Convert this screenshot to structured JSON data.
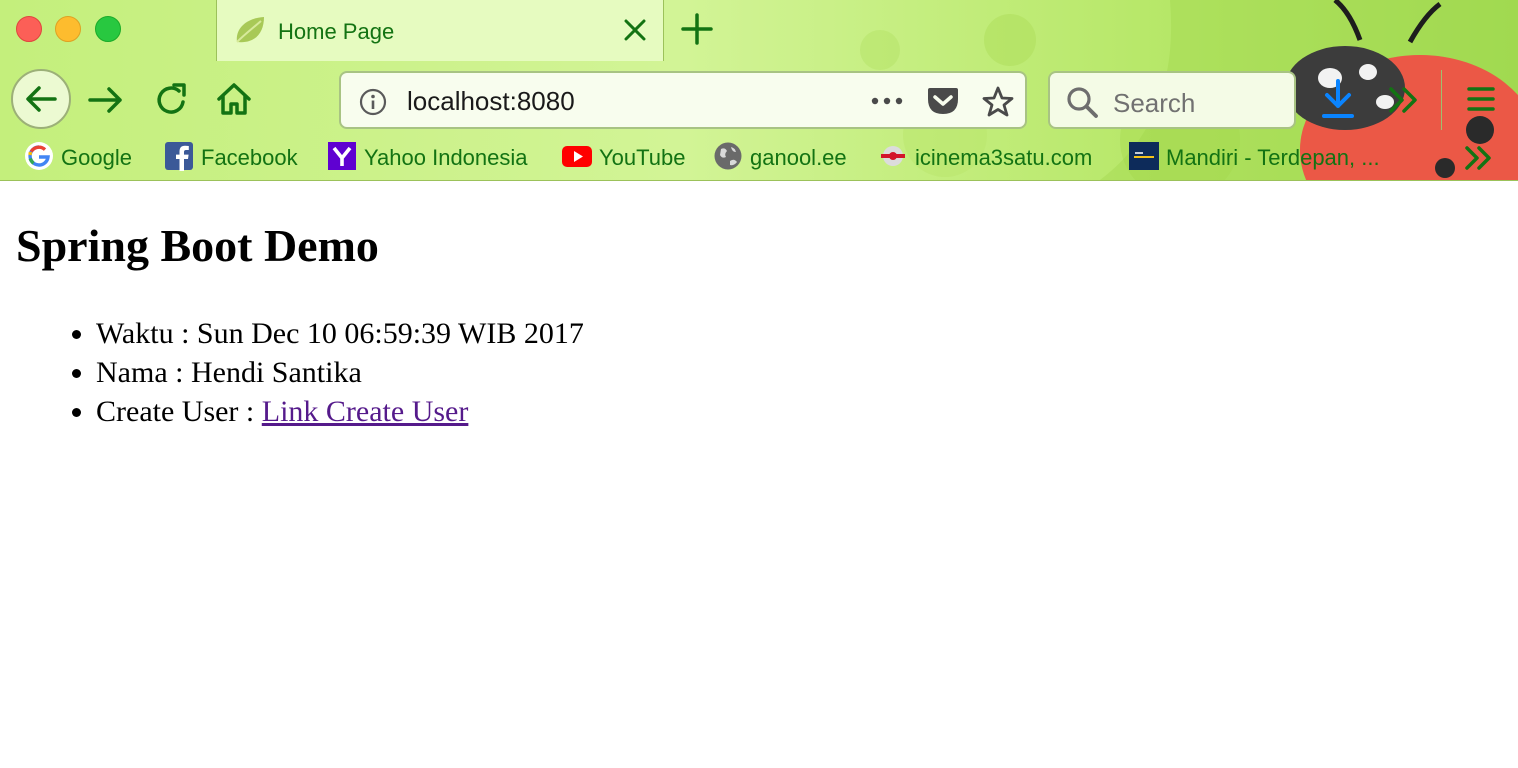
{
  "browser": {
    "tab": {
      "title": "Home Page"
    },
    "url": "localhost:8080",
    "search_placeholder": "Search",
    "bookmarks": [
      {
        "label": "Google",
        "icon": "google-icon"
      },
      {
        "label": "Facebook",
        "icon": "facebook-icon"
      },
      {
        "label": "Yahoo Indonesia",
        "icon": "yahoo-icon"
      },
      {
        "label": "YouTube",
        "icon": "youtube-icon"
      },
      {
        "label": "ganool.ee",
        "icon": "globe-icon"
      },
      {
        "label": "icinema3satu.com",
        "icon": "icinema-icon"
      },
      {
        "label": "Mandiri - Terdepan, ...",
        "icon": "mandiri-icon"
      }
    ],
    "colors": {
      "toolbar_icon": "#137313",
      "download_icon": "#0a84ff",
      "theme_green": "#c4ef7c"
    }
  },
  "page": {
    "heading": "Spring Boot Demo",
    "items": [
      {
        "label": "Waktu : ",
        "value": "Sun Dec 10 06:59:39 WIB 2017"
      },
      {
        "label": "Nama : ",
        "value": "Hendi Santika"
      },
      {
        "label": "Create User : ",
        "link": "Link Create User"
      }
    ],
    "colors": {
      "link_visited": "#551a8b"
    }
  }
}
